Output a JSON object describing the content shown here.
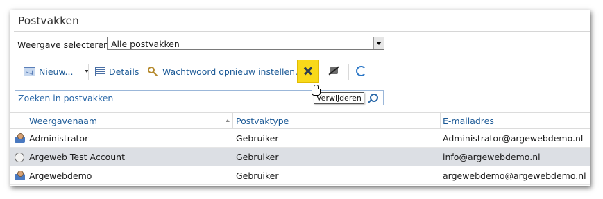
{
  "panel": {
    "title": "Postvakken"
  },
  "view": {
    "label": "Weergave selecteren:",
    "selected": "Alle postvakken"
  },
  "toolbar": {
    "new_label": "Nieuw...",
    "details_label": "Details",
    "reset_password_label": "Wachtwoord opnieuw instellen...",
    "delete_tooltip": "Verwijderen"
  },
  "search": {
    "placeholder": "Zoeken in postvakken"
  },
  "table": {
    "columns": [
      "Weergavenaam",
      "Postvaktype",
      "E-mailadres"
    ],
    "rows": [
      {
        "icon": "mailbox-user-icon",
        "name": "Administrator",
        "type": "Gebruiker",
        "email": "Administrator@argewebdemo.nl",
        "selected": false
      },
      {
        "icon": "mailbox-pending-icon",
        "name": "Argeweb Test Account",
        "type": "Gebruiker",
        "email": "info@argewebdemo.nl",
        "selected": true
      },
      {
        "icon": "mailbox-user-icon",
        "name": "Argewebdemo",
        "type": "Gebruiker",
        "email": "argewebdemo@argewebdemo.nl",
        "selected": false
      }
    ]
  },
  "colors": {
    "accent": "#1e5b97",
    "delete_highlight": "#f8d91a",
    "selected_row": "#dcdfe4"
  }
}
